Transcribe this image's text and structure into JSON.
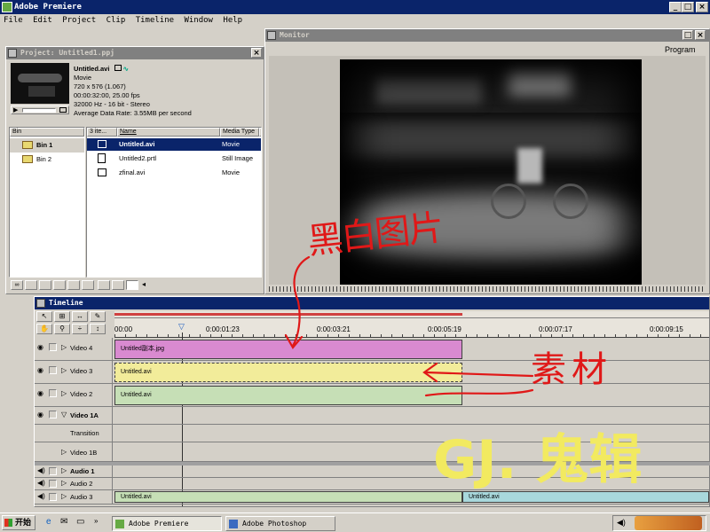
{
  "app": {
    "title": "Adobe Premiere",
    "menu": [
      "File",
      "Edit",
      "Project",
      "Clip",
      "Timeline",
      "Window",
      "Help"
    ],
    "window_controls": [
      "_",
      "□",
      "×"
    ]
  },
  "project": {
    "title": "Project: Untitled1.ppj",
    "preview": {
      "name": "Untitled.avi",
      "type": "Movie",
      "dimensions": "720 x 576 (1.067)",
      "duration": "00:00:32:00, 25.00 fps",
      "audio": "32000 Hz - 16 bit - Stereo",
      "datarate": "Average Data Rate: 3.55MB per second"
    },
    "bins_header": "Bin",
    "bins": [
      "Bin 1",
      "Bin 2"
    ],
    "columns": [
      "3 ite...",
      "Name",
      "Media Type",
      "D"
    ],
    "items": [
      {
        "name": "Untitled.avi",
        "media_type": "Movie",
        "selected": true
      },
      {
        "name": "Untitled2.prtl",
        "media_type": "Still Image",
        "selected": false
      },
      {
        "name": "zfinal.avi",
        "media_type": "Movie",
        "selected": false
      }
    ]
  },
  "monitor": {
    "title": "Monitor",
    "mode": "Program"
  },
  "timeline": {
    "title": "Timeline",
    "ruler": [
      "00:00",
      "0:00:01:23",
      "0:00:03:21",
      "0:00:05:19",
      "0:00:07:17",
      "0:00:09:15"
    ],
    "tracks": {
      "video4": "Video 4",
      "video3": "Video 3",
      "video2": "Video 2",
      "video1a": "Video 1A",
      "transition": "Transition",
      "video1b": "Video 1B",
      "audio1": "Audio 1",
      "audio2": "Audio 2",
      "audio3": "Audio 3"
    },
    "clips": {
      "v4": "Untitled副本.jpg",
      "v3": "Untitled.avi",
      "v2": "Untitled.avi",
      "a3a": "Untitled.avi",
      "a3b": "Untitled.avi"
    }
  },
  "annotations": {
    "red_top": "黑白图片",
    "red_mid": "素材",
    "watermark": "GJ. 鬼辑"
  },
  "taskbar": {
    "start": "开始",
    "tasks": [
      "Adobe Premiere",
      "Adobe Photoshop"
    ]
  },
  "colors": {
    "titlebar_active": "#0a246a",
    "clip_pink": "#d98ad0",
    "clip_yellow": "#f2ec9a",
    "clip_green": "#c6dfb6",
    "clip_teal": "#a8d8dc",
    "annotation_red": "#e01818",
    "watermark_yellow": "#f2ea60"
  }
}
